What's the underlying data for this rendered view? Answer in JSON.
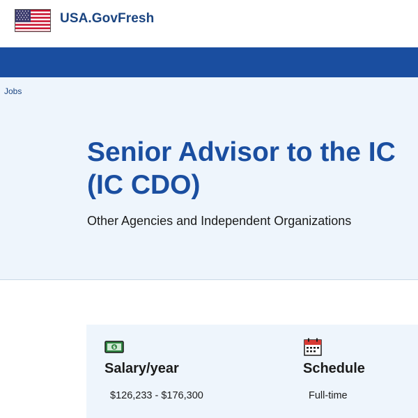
{
  "header": {
    "brand": "USA.GovFresh",
    "flag_icon": "us-flag-icon"
  },
  "breadcrumb": {
    "label": "Jobs"
  },
  "job": {
    "title_line1": "Senior Advisor to the IC",
    "title_line2": "(IC CDO)",
    "agency": "Other Agencies and Independent Organizations"
  },
  "summary": {
    "salary": {
      "icon": "money-icon",
      "label": "Salary/year",
      "value": "$126,233 - $176,300"
    },
    "schedule": {
      "icon": "calendar-icon",
      "label": "Schedule",
      "value": "Full-time"
    }
  },
  "colors": {
    "brand_blue": "#1a4ea0",
    "link_blue": "#1a4480",
    "hero_bg": "#eef5fc"
  }
}
